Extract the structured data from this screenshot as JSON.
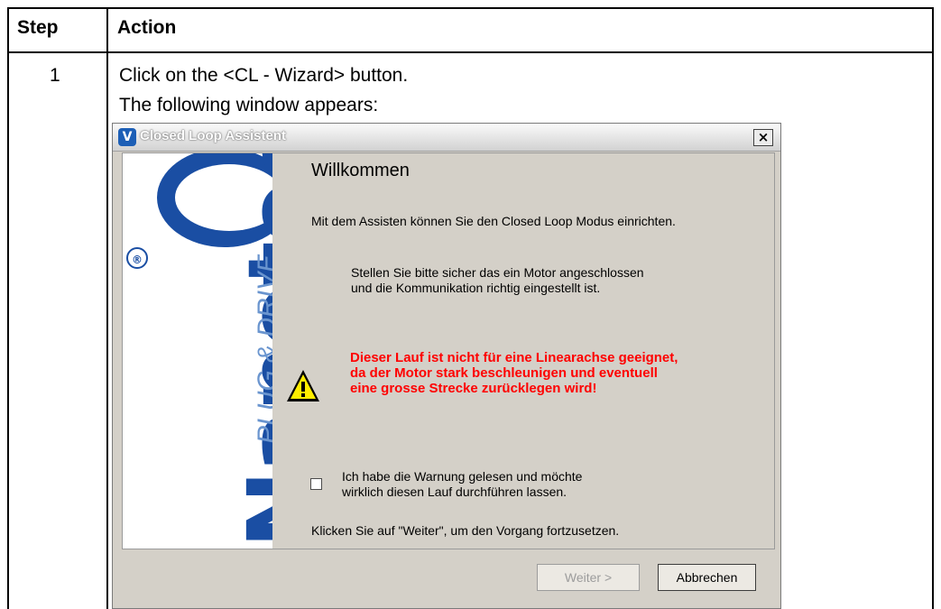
{
  "table": {
    "headers": {
      "step": "Step",
      "action": "Action"
    },
    "row": {
      "step": "1",
      "instruction": "Click on the <CL - Wizard> button.",
      "result": "The following window appears:"
    }
  },
  "dialog": {
    "title": "Closed Loop Assistent",
    "app_icon_glyph": "V",
    "close_glyph": "×",
    "banner": {
      "brand": "Nanotec",
      "tagline": "PLUG & DRIVE",
      "registered": "®"
    },
    "heading": "Willkommen",
    "intro": "Mit dem Assisten können Sie den Closed Loop Modus einrichten.",
    "check_lines": [
      "Stellen Sie bitte sicher das ein Motor angeschlossen",
      "und die Kommunikation richtig eingestellt ist."
    ],
    "warning_lines": [
      "Dieser Lauf ist nicht für eine Linearachse geeignet,",
      "da der Motor stark beschleunigen und eventuell",
      "eine grosse Strecke zurücklegen wird!"
    ],
    "confirm_lines": [
      "Ich habe die Warnung gelesen und möchte",
      "wirklich diesen Lauf durchführen lassen."
    ],
    "confirm_checked": false,
    "continue_hint": "Klicken Sie auf \"Weiter\", um den Vorgang fortzusetzen.",
    "buttons": {
      "next": "Weiter >",
      "cancel": "Abbrechen"
    },
    "colors": {
      "warning_text": "#ff0000",
      "brand_blue": "#1a4ea3",
      "dialog_face": "#d4d0c8"
    },
    "icons": {
      "warning": "warning-triangle-icon"
    }
  }
}
